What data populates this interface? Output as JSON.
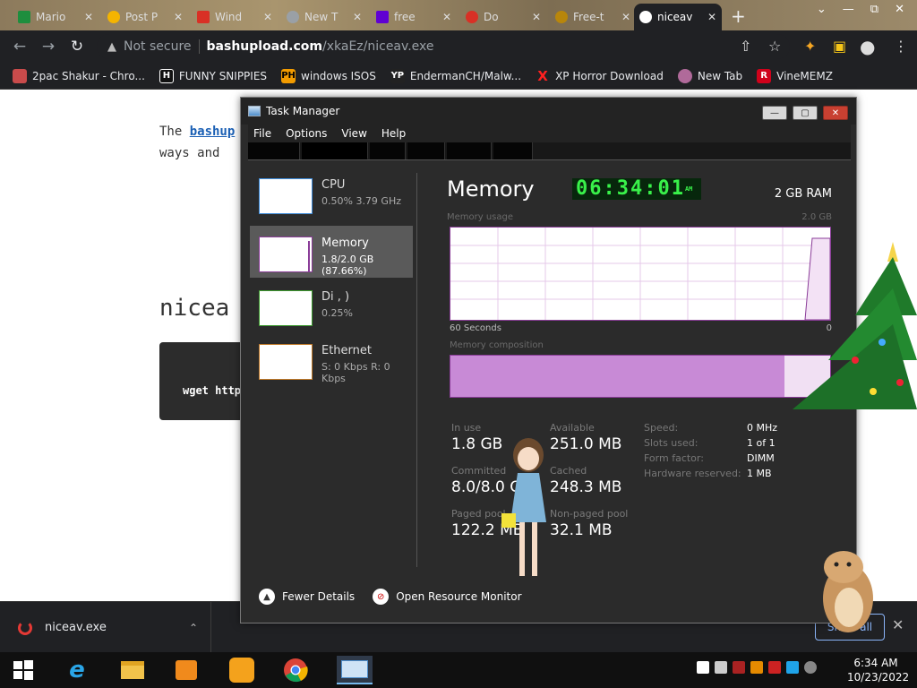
{
  "browser": {
    "tabs": [
      {
        "label": "Mario",
        "color": "#1e8e3e"
      },
      {
        "label": "Post P",
        "color": "#f4b400"
      },
      {
        "label": "Wind",
        "color": "#d93025"
      },
      {
        "label": "New T",
        "color": "#9aa0a6"
      },
      {
        "label": "free",
        "color": "#6001d2"
      },
      {
        "label": "Do",
        "color": "#d93025"
      },
      {
        "label": "Free-t",
        "color": "#b8860b"
      },
      {
        "label": "niceav",
        "color": "#ffffff"
      }
    ],
    "new_tab": "+",
    "window_controls": [
      "⌄",
      "—",
      "⧉",
      "✕"
    ],
    "nav": {
      "back": "←",
      "forward": "→",
      "reload": "↻"
    },
    "security_label": "Not secure",
    "url_host": "bashupload.com",
    "url_path": "/xkaEz/niceav.exe",
    "toolbar_icons": [
      "⇧",
      "☆",
      "✦",
      "▣",
      "●",
      "⋮"
    ]
  },
  "bookmarks": [
    {
      "label": "2pac Shakur - Chro...",
      "icon": "red-icon",
      "badge": "",
      "color": "#c94b4b"
    },
    {
      "label": "FUNNY SNIPPIES",
      "icon": "h-icon",
      "badge": "H",
      "color": "#111"
    },
    {
      "label": "windows ISOS",
      "icon": "ph-icon",
      "badge": "PH",
      "color": "#f29b00"
    },
    {
      "label": "EndermanCH/Malw...",
      "icon": "yt-icon",
      "badge": "YP",
      "color": "#222"
    },
    {
      "label": "XP Horror Download",
      "icon": "x-icon",
      "badge": "X",
      "color": "#d60000"
    },
    {
      "label": "New Tab",
      "icon": "globe-icon",
      "badge": "",
      "color": "#b06a9a"
    },
    {
      "label": "VineMEMZ",
      "icon": "r-icon",
      "badge": "R",
      "color": "#d0021b"
    }
  ],
  "page": {
    "line1_prefix": "The ",
    "line1_link": "bashup",
    "line2": "ways and",
    "heading": "nicea",
    "code": "wget http"
  },
  "download": {
    "filename": "niceav.exe",
    "chevron": "⌃",
    "show_all": "Show all",
    "close": "✕"
  },
  "taskmgr": {
    "title": "Task Manager",
    "menu": [
      "File",
      "Options",
      "View",
      "Help"
    ],
    "window_controls": {
      "min": "—",
      "max": "▢",
      "close": "✕"
    },
    "sidebar": [
      {
        "name": "CPU",
        "sub": "0.50%  3.79 GHz",
        "color": "#3d8bd9"
      },
      {
        "name": "Memory",
        "sub": "1.8/2.0 GB (87.66%)",
        "color": "#8a3c98"
      },
      {
        "name": "Di    ,  )",
        "sub": "0.25%",
        "color": "#3c9a2e"
      },
      {
        "name": "Ethernet",
        "sub": "S: 0 Kbps R: 0 Kbps",
        "color": "#c07a2a"
      }
    ],
    "panel_title": "Memory",
    "clock": "06:34:01",
    "clock_ampm": "AM",
    "total_ram": "2 GB RAM",
    "usage_label": "Memory usage",
    "usage_max": "2.0 GB",
    "time_left": "60 Seconds",
    "time_right": "0",
    "composition_label": "Memory composition",
    "composition_used_fraction": 0.88,
    "stats": {
      "in_use_label": "In use",
      "in_use": "1.8 GB",
      "available_label": "Available",
      "available": "251.0 MB",
      "committed_label": "Committed",
      "committed": "8.0/8.0 G",
      "cached_label": "Cached",
      "cached": "248.3 MB",
      "paged_label": "Paged pool",
      "paged": "122.2 MB",
      "nonpaged_label": "Non-paged pool",
      "nonpaged": "32.1 MB"
    },
    "details": [
      {
        "label": "Speed:",
        "value": "0 MHz"
      },
      {
        "label": "Slots used:",
        "value": "1 of 1"
      },
      {
        "label": "Form factor:",
        "value": "DIMM"
      },
      {
        "label": "Hardware reserved:",
        "value": "1 MB"
      }
    ],
    "footer": {
      "fewer": "Fewer Details",
      "monitor": "Open Resource Monitor"
    },
    "accent": "#8a3c98"
  },
  "taskbar": {
    "time": "6:34 AM",
    "date": "10/23/2022"
  }
}
